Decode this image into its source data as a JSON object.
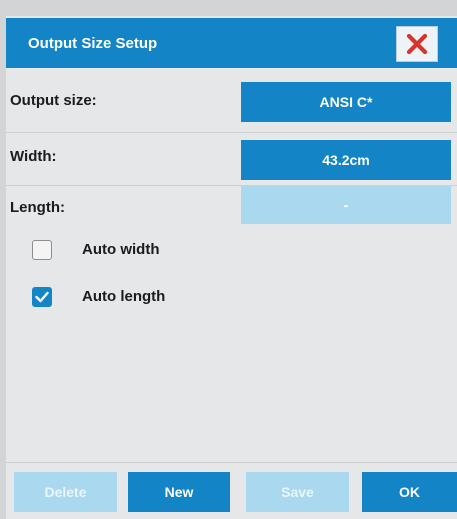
{
  "dialog": {
    "title": "Output Size Setup",
    "close_icon": "close-x-icon",
    "accent_color": "#1385c6",
    "disabled_color": "#a9d8ef",
    "close_color": "#d7352b"
  },
  "fields": {
    "output_size": {
      "label": "Output size:",
      "value": "ANSI C*"
    },
    "width": {
      "label": "Width:",
      "value": "43.2cm"
    },
    "length": {
      "label": "Length:",
      "value": "-",
      "disabled": true
    }
  },
  "options": {
    "auto_width": {
      "label": "Auto width",
      "checked": false
    },
    "auto_length": {
      "label": "Auto length",
      "checked": true
    }
  },
  "buttons": {
    "delete": {
      "label": "Delete",
      "disabled": true
    },
    "new": {
      "label": "New",
      "disabled": false
    },
    "save": {
      "label": "Save",
      "disabled": true
    },
    "ok": {
      "label": "OK",
      "disabled": false
    }
  }
}
